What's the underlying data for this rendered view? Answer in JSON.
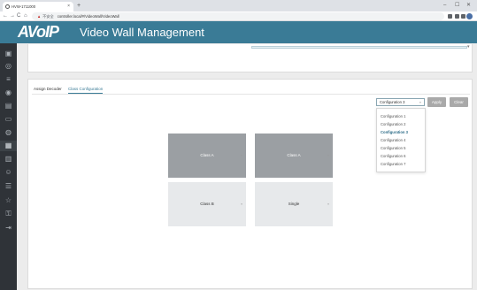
{
  "browser": {
    "tab_title": "HVW-1711000",
    "tab_close": "×",
    "new_tab": "+",
    "win_min": "–",
    "win_max": "☐",
    "win_close": "✕",
    "nav_back": "←",
    "nav_forward": "→",
    "nav_reload": "C",
    "nav_home": "⌂",
    "warn_icon": "▲",
    "security_label": "不安全",
    "url": "controller.local/#/VideoWall/VideoWall"
  },
  "app": {
    "logo": "AVoIP",
    "title": "Video Wall Management",
    "accent_color": "#3a7b96"
  },
  "sidebar": {
    "icons": [
      "image-icon",
      "globe-icon",
      "list-icon",
      "layers-icon",
      "display-icon",
      "monitor-icon",
      "camera-icon",
      "video-wall-icon",
      "grid-icon",
      "users-icon",
      "sliders-icon",
      "star-icon",
      "key-icon",
      "logout-icon"
    ],
    "glyphs": [
      "▣",
      "◎",
      "≡",
      "◉",
      "▤",
      "▭",
      "◍",
      "▦",
      "▥",
      "☺",
      "☰",
      "☆",
      "⚿",
      "⇥"
    ]
  },
  "top_panel": {
    "caret": "▾"
  },
  "tabs": [
    {
      "label": "Assign Decoder"
    },
    {
      "label": "Class Configuration"
    }
  ],
  "toolbar": {
    "selected_config": "Configuration 3",
    "select_caret": "▿",
    "apply_label": "Apply",
    "clear_label": "Clear"
  },
  "dropdown": {
    "options": [
      "Configuration 1",
      "Configuration 2",
      "Configuration 3",
      "Configuration 4",
      "Configuration 5",
      "Configuration 6",
      "Configuration 7"
    ],
    "selected": "Configuration 3"
  },
  "classes": [
    {
      "label": "Class A",
      "style": "dark",
      "caret": "▿"
    },
    {
      "label": "Class A",
      "style": "dark",
      "caret": "▿"
    },
    {
      "label": "Class B",
      "style": "light",
      "caret": "▿"
    },
    {
      "label": "Single",
      "style": "light",
      "caret": "▿"
    }
  ]
}
